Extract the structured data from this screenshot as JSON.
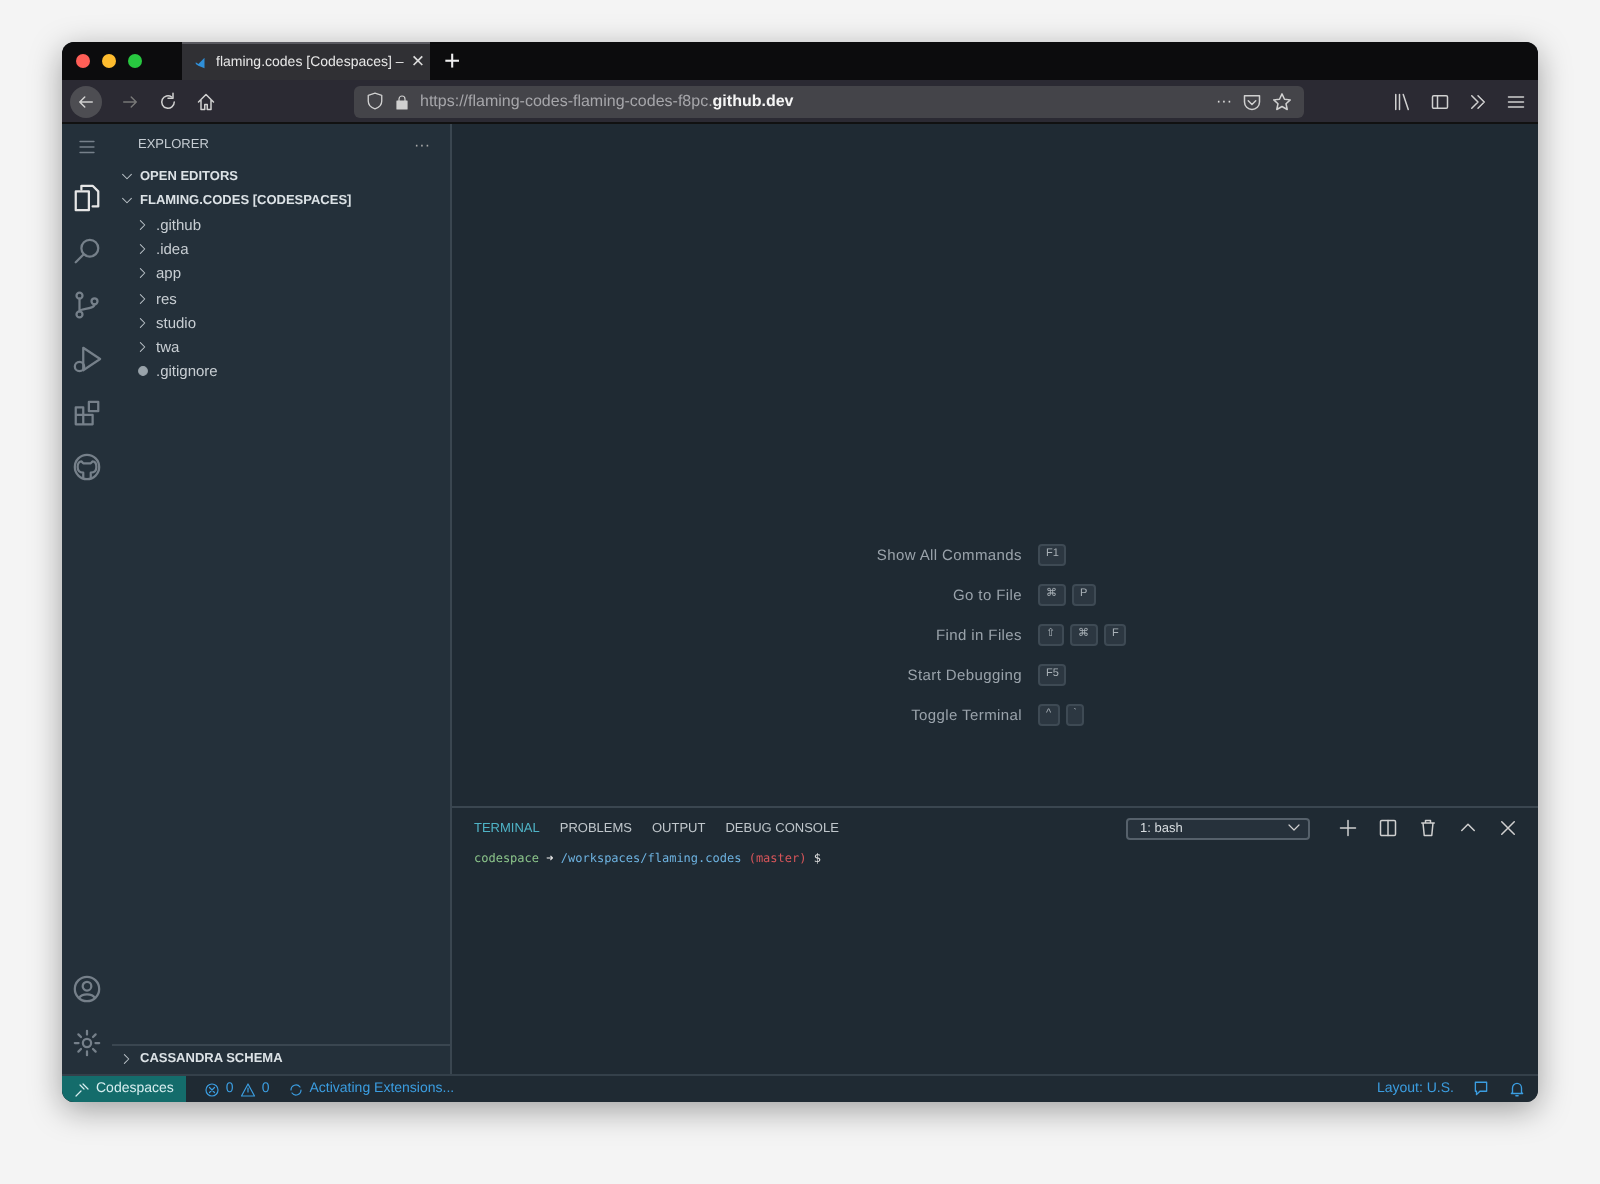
{
  "browser": {
    "tab": {
      "title": "flaming.codes [Codespaces] –",
      "close": "×"
    },
    "new_tab": "+",
    "url": "https://flaming-codes-flaming-codes-f8pc.**github.dev**",
    "url_more": "···"
  },
  "activity_bar": {
    "top": [
      {
        "kind": "files",
        "selected": true
      },
      {
        "kind": "search",
        "selected": false
      },
      {
        "kind": "source-control",
        "selected": false
      },
      {
        "kind": "run",
        "selected": false
      },
      {
        "kind": "extensions",
        "selected": false
      },
      {
        "kind": "github",
        "selected": false
      }
    ],
    "bottom": [
      {
        "kind": "account"
      },
      {
        "kind": "settings"
      }
    ]
  },
  "sidebar": {
    "title": "EXPLORER",
    "more": "···",
    "sections": [
      {
        "label": "OPEN EDITORS",
        "expanded": true
      },
      {
        "label": "FLAMING.CODES [CODESPACES]",
        "expanded": true,
        "items": [
          {
            "kind": "folder",
            "name": ".github",
            "expanded": false
          },
          {
            "kind": "folder",
            "name": ".idea",
            "expanded": false
          },
          {
            "kind": "folder",
            "name": "app",
            "expanded": false
          },
          {
            "kind": "folder",
            "name": "res",
            "expanded": false
          },
          {
            "kind": "folder",
            "name": "studio",
            "expanded": false
          },
          {
            "kind": "folder",
            "name": "twa",
            "expanded": false
          },
          {
            "kind": "file",
            "name": ".gitignore"
          }
        ]
      }
    ],
    "bottom_section": {
      "label": "CASSANDRA SCHEMA",
      "expanded": false
    }
  },
  "welcome": {
    "commands": [
      {
        "label": "Show All Commands",
        "keys": [
          "F1"
        ]
      },
      {
        "label": "Go to File",
        "keys": [
          "⌘",
          "P"
        ]
      },
      {
        "label": "Find in Files",
        "keys": [
          "⇧",
          "⌘",
          "F"
        ]
      },
      {
        "label": "Start Debugging",
        "keys": [
          "F5"
        ]
      },
      {
        "label": "Toggle Terminal",
        "keys": [
          "^",
          "`"
        ]
      }
    ]
  },
  "panel": {
    "tabs": [
      {
        "label": "TERMINAL",
        "selected": true
      },
      {
        "label": "PROBLEMS",
        "selected": false
      },
      {
        "label": "OUTPUT",
        "selected": false
      },
      {
        "label": "DEBUG CONSOLE",
        "selected": false
      }
    ],
    "terminal_select": "1: bash",
    "prompt": {
      "user": "codespace",
      "arrow": "➜",
      "path": "/workspaces/flaming.codes",
      "branch": "(master)",
      "symbol": "$"
    }
  },
  "status_bar": {
    "remote": "Codespaces",
    "errors": "0",
    "warnings": "0",
    "activity": "Activating Extensions...",
    "layout": "Layout: U.S."
  }
}
